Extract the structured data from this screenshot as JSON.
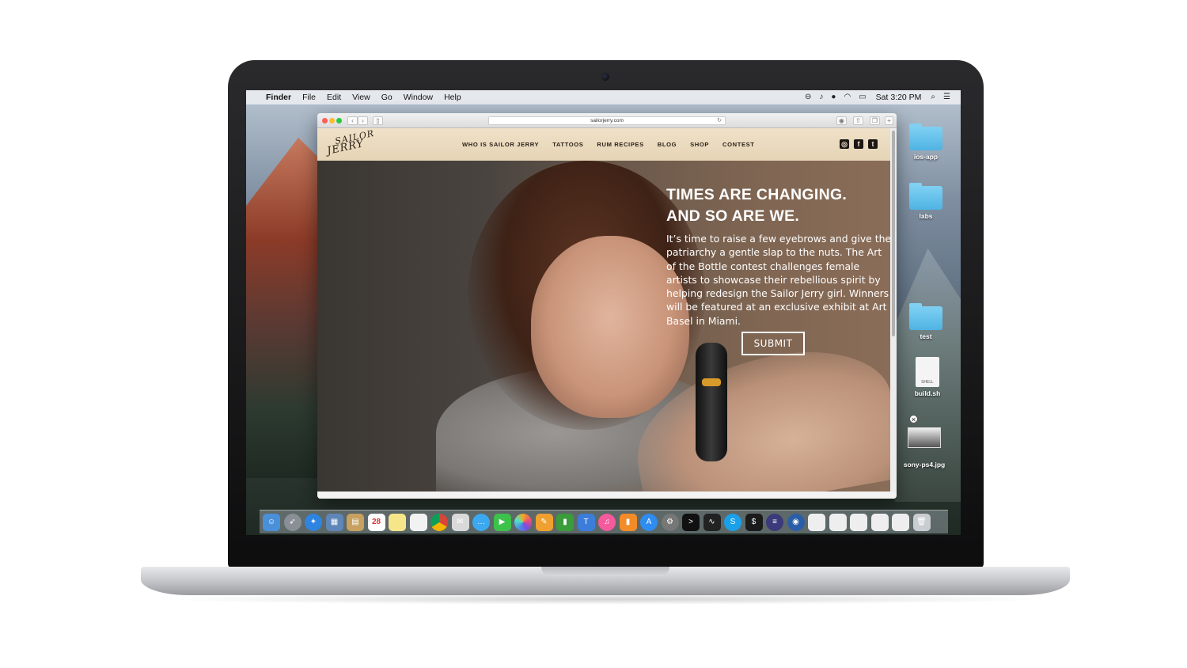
{
  "menubar": {
    "apple_icon": "apple-icon",
    "app": "Finder",
    "menus": [
      "File",
      "Edit",
      "View",
      "Go",
      "Window",
      "Help"
    ],
    "clock": "Sat 3:20 PM",
    "status_icons": [
      "screen-share-icon",
      "notification-bell-icon",
      "ghost-icon",
      "wifi-icon",
      "battery-icon",
      "spotlight-search-icon",
      "notification-center-icon"
    ]
  },
  "browser": {
    "url": "sailorjerry.com",
    "site": {
      "logo_top": "SAILOR",
      "logo_bottom": "JERRY",
      "nav": [
        "WHO IS SAILOR JERRY",
        "TATTOOS",
        "RUM RECIPES",
        "BLOG",
        "SHOP",
        "CONTEST"
      ],
      "social": [
        "instagram-icon",
        "facebook-icon",
        "twitter-icon"
      ],
      "hero": {
        "title_line1": "TIMES ARE CHANGING.",
        "title_line2": "AND SO ARE WE.",
        "body": "It’s time to raise a few eyebrows and give the patriarchy a gentle slap to the nuts. The Art of the Bottle contest challenges female artists to showcase their rebellious spirit by helping redesign the Sailor Jerry girl. Winners will be featured at an exclusive exhibit at Art Basel in Miami.",
        "button": "SUBMIT"
      }
    }
  },
  "desktop": {
    "items": [
      {
        "label": "ios-app",
        "type": "folder"
      },
      {
        "label": "labs",
        "type": "folder"
      },
      {
        "label": "test",
        "type": "folder"
      },
      {
        "label": "build.sh",
        "type": "file",
        "badge": "SHELL"
      },
      {
        "label": "sony-ps4.jpg",
        "type": "image"
      }
    ]
  },
  "dock": {
    "icons": [
      "finder-icon",
      "launchpad-icon",
      "safari-icon",
      "preview-icon",
      "notes-icon",
      "calendar-icon",
      "stickies-icon",
      "textedit-icon",
      "chrome-icon",
      "mail-icon",
      "messages-icon",
      "facetime-icon",
      "photos-icon",
      "pages-icon",
      "numbers-icon",
      "keynote-icon",
      "itunes-icon",
      "ibooks-icon",
      "app-store-icon",
      "system-preferences-icon",
      "terminal-icon",
      "activity-monitor-icon",
      "skype-icon",
      "console-icon",
      "eclipse-icon",
      "firefox-icon",
      "window-thumb-1",
      "window-thumb-2",
      "window-thumb-3",
      "window-thumb-4",
      "window-thumb-5",
      "trash-icon"
    ],
    "calendar_day": "28"
  }
}
